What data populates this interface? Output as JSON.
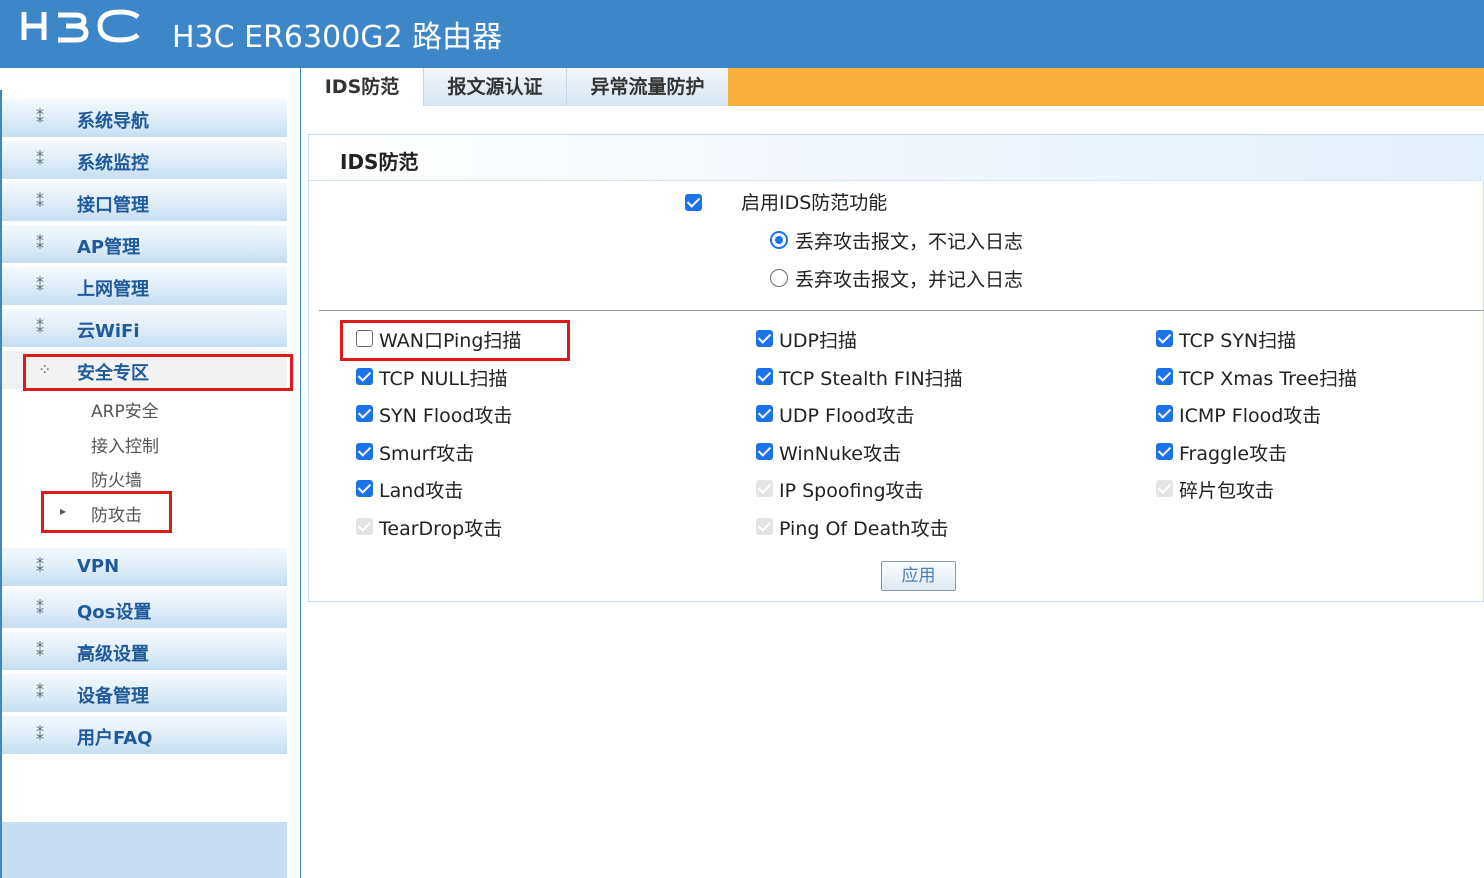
{
  "header": {
    "logo_text": "H3C",
    "title": "H3C ER6300G2 路由器"
  },
  "sidebar": {
    "items_top": [
      {
        "label": "系统导航",
        "icon": "expand-arrows-icon"
      },
      {
        "label": "系统监控",
        "icon": "expand-arrows-icon"
      },
      {
        "label": "接口管理",
        "icon": "expand-arrows-icon"
      },
      {
        "label": "AP管理",
        "icon": "expand-arrows-icon"
      },
      {
        "label": "上网管理",
        "icon": "expand-arrows-icon"
      },
      {
        "label": "云WiFi",
        "icon": "expand-arrows-icon"
      },
      {
        "label": "安全专区",
        "icon": "collapse-arrows-icon",
        "expanded": true
      }
    ],
    "subitems": [
      "ARP安全",
      "接入控制",
      "防火墙",
      "防攻击"
    ],
    "active_subitem": "防攻击",
    "items_bottom": [
      {
        "label": "VPN",
        "icon": "expand-arrows-icon"
      },
      {
        "label": "Qos设置",
        "icon": "expand-arrows-icon"
      },
      {
        "label": "高级设置",
        "icon": "expand-arrows-icon"
      },
      {
        "label": "设备管理",
        "icon": "expand-arrows-icon"
      },
      {
        "label": "用户FAQ",
        "icon": "expand-arrows-icon"
      }
    ]
  },
  "tabs": [
    {
      "label": "IDS防范",
      "active": true
    },
    {
      "label": "报文源认证",
      "active": false
    },
    {
      "label": "异常流量防护",
      "active": false
    }
  ],
  "panel": {
    "title": "IDS防范",
    "enable": {
      "label": "启用IDS防范功能",
      "checked": true
    },
    "mode_options": [
      {
        "label": "丢弃攻击报文，不记入日志",
        "selected": true
      },
      {
        "label": "丢弃攻击报文，并记入日志",
        "selected": false
      }
    ],
    "options": [
      {
        "label": "WAN口Ping扫描",
        "state": "unchecked"
      },
      {
        "label": "UDP扫描",
        "state": "checked"
      },
      {
        "label": "TCP SYN扫描",
        "state": "checked"
      },
      {
        "label": "TCP NULL扫描",
        "state": "checked"
      },
      {
        "label": "TCP Stealth FIN扫描",
        "state": "checked"
      },
      {
        "label": "TCP Xmas Tree扫描",
        "state": "checked"
      },
      {
        "label": "SYN Flood攻击",
        "state": "checked"
      },
      {
        "label": "UDP Flood攻击",
        "state": "checked"
      },
      {
        "label": "ICMP Flood攻击",
        "state": "checked"
      },
      {
        "label": "Smurf攻击",
        "state": "checked"
      },
      {
        "label": "WinNuke攻击",
        "state": "checked"
      },
      {
        "label": "Fraggle攻击",
        "state": "checked"
      },
      {
        "label": "Land攻击",
        "state": "checked"
      },
      {
        "label": "IP Spoofing攻击",
        "state": "disabled-checked"
      },
      {
        "label": "碎片包攻击",
        "state": "disabled-checked"
      },
      {
        "label": "TearDrop攻击",
        "state": "disabled-checked"
      },
      {
        "label": "Ping Of Death攻击",
        "state": "disabled-checked"
      }
    ],
    "apply_label": "应用"
  },
  "colors": {
    "header_bg": "#3d86c8",
    "tab_bar": "#f8b13e",
    "menu_text": "#1f5a9a",
    "highlight_box": "#dd1a1a",
    "checkbox": "#1a73e8"
  }
}
